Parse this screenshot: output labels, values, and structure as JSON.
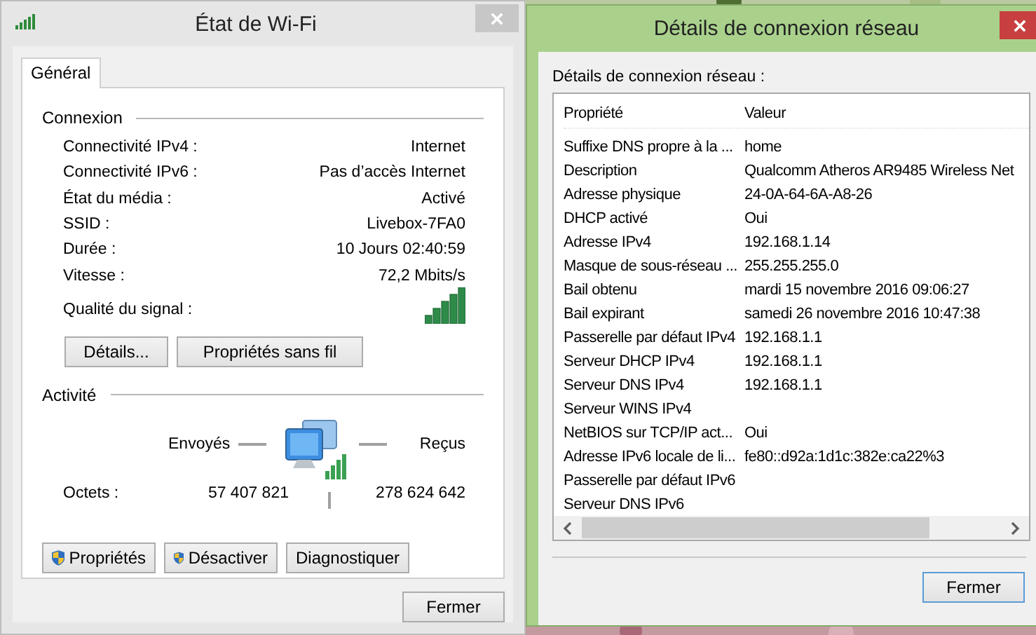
{
  "wifi_status": {
    "title": "État de Wi-Fi",
    "tabs": [
      {
        "label": "Général",
        "selected": true
      }
    ],
    "connection": {
      "heading": "Connexion",
      "fields": [
        {
          "label": "Connectivité IPv4 :",
          "value": "Internet"
        },
        {
          "label": "Connectivité IPv6 :",
          "value": "Pas d’accès Internet"
        },
        {
          "label": "État du média :",
          "value": "Activé"
        },
        {
          "label": "SSID :",
          "value": "Livebox-7FA0"
        },
        {
          "label": "Durée :",
          "value": "10 Jours 02:40:59"
        },
        {
          "label": "Vitesse :",
          "value": "72,2 Mbits/s"
        }
      ],
      "signal_label": "Qualité du signal :",
      "buttons": [
        "Détails...",
        "Propriétés sans fil"
      ]
    },
    "activity": {
      "heading": "Activité",
      "sent_label": "Envoyés",
      "received_label": "Reçus",
      "bytes_label": "Octets :",
      "bytes_sent": "57 407 821",
      "bytes_received": "278 624 642"
    },
    "actions": [
      {
        "label": "Propriétés",
        "kind": "shield"
      },
      {
        "label": "Désactiver",
        "kind": "shield"
      },
      {
        "label": "Diagnostiquer",
        "kind": "plain"
      }
    ],
    "close_button": "Fermer"
  },
  "details": {
    "title": "Détails de connexion réseau",
    "caption": "Détails de connexion réseau :",
    "columns": [
      "Propriété",
      "Valeur"
    ],
    "rows": [
      {
        "property": "Suffixe DNS propre à la ...",
        "value": "home"
      },
      {
        "property": "Description",
        "value": "Qualcomm Atheros AR9485 Wireless Net"
      },
      {
        "property": "Adresse physique",
        "value": "24-0A-64-6A-A8-26"
      },
      {
        "property": "DHCP activé",
        "value": "Oui"
      },
      {
        "property": "Adresse IPv4",
        "value": "192.168.1.14"
      },
      {
        "property": "Masque de sous-réseau ...",
        "value": "255.255.255.0"
      },
      {
        "property": "Bail obtenu",
        "value": "mardi 15 novembre 2016 09:06:27"
      },
      {
        "property": "Bail expirant",
        "value": "samedi 26 novembre 2016 10:47:38"
      },
      {
        "property": "Passerelle par défaut IPv4",
        "value": "192.168.1.1"
      },
      {
        "property": "Serveur DHCP IPv4",
        "value": "192.168.1.1"
      },
      {
        "property": "Serveur DNS IPv4",
        "value": "192.168.1.1"
      },
      {
        "property": "Serveur WINS IPv4"
      },
      {
        "property": "NetBIOS sur TCP/IP act...",
        "value": "Oui"
      },
      {
        "property": "Adresse IPv6 locale de li...",
        "value": "fe80::d92a:1d1c:382e:ca22%3"
      },
      {
        "property": "Passerelle par défaut IPv6"
      },
      {
        "property": "Serveur DNS IPv6"
      }
    ],
    "close_button": "Fermer"
  }
}
